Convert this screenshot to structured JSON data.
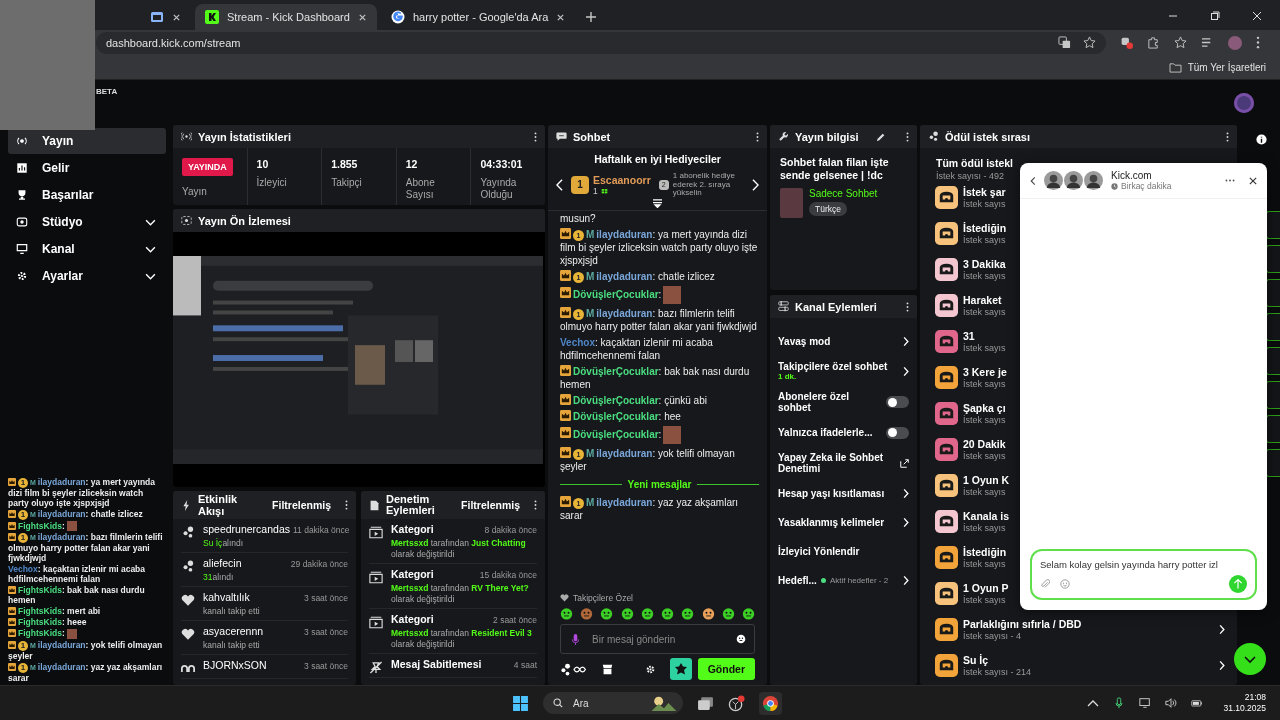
{
  "browser": {
    "tabs": [
      {
        "selected": false
      },
      {
        "title": "Stream - Kick Dashboard",
        "selected": true
      },
      {
        "title": "harry potter - Google'da Ara",
        "selected": false
      }
    ],
    "address": "dashboard.kick.com/stream",
    "bookmarks_folder": "Tüm Yer İşaretleri"
  },
  "header": {
    "badge": "BETA"
  },
  "sidebar": [
    {
      "label": "Yayın",
      "selected": true,
      "expandable": false
    },
    {
      "label": "Gelir",
      "selected": false,
      "expandable": false
    },
    {
      "label": "Başarılar",
      "selected": false,
      "expandable": false
    },
    {
      "label": "Stüdyo",
      "selected": false,
      "expandable": true
    },
    {
      "label": "Kanal",
      "selected": false,
      "expandable": true
    },
    {
      "label": "Ayarlar",
      "selected": false,
      "expandable": true
    }
  ],
  "stream_overlay": {
    "messages": [
      {
        "user": "ilaydaduran",
        "color": "#7aa7d9",
        "badges": [
          {
            "kind": "crown"
          },
          {
            "kind": "sub",
            "label": "1"
          },
          {
            "kind": "mod",
            "label": "M"
          }
        ],
        "kind": "text",
        "text": ": ya mert yayında dizi film bi şeyler izliceksin watch party oluyo işte xjspxjsjd"
      },
      {
        "user": "ilaydaduran",
        "color": "#7aa7d9",
        "badges": [
          {
            "kind": "crown"
          },
          {
            "kind": "sub",
            "label": "1"
          },
          {
            "kind": "mod",
            "label": "M"
          }
        ],
        "kind": "text",
        "text": ": chatle izlicez"
      },
      {
        "user": "FightsKids",
        "color": "#4ade80",
        "badges": [
          {
            "kind": "crown"
          }
        ],
        "kind": "emote",
        "text": ":"
      },
      {
        "user": "ilaydaduran",
        "color": "#7aa7d9",
        "badges": [
          {
            "kind": "crown"
          },
          {
            "kind": "sub",
            "label": "1"
          },
          {
            "kind": "mod",
            "label": "M"
          }
        ],
        "kind": "text",
        "text": ": bazı filmlerin telifi olmuyo harry potter falan akar yani fjwkdjwjd"
      },
      {
        "user": "Vechox",
        "color": "#4f86c6",
        "kind": "text",
        "text": ": kaçaktan izlenir mi acaba hdfilmcehennemi falan"
      },
      {
        "user": "FightsKids",
        "color": "#4ade80",
        "badges": [
          {
            "kind": "crown"
          }
        ],
        "kind": "text",
        "text": ": bak bak nası durdu hemen"
      },
      {
        "user": "FightsKids",
        "color": "#4ade80",
        "badges": [
          {
            "kind": "crown"
          }
        ],
        "kind": "text",
        "text": ": mert abi"
      },
      {
        "user": "FightsKids",
        "color": "#4ade80",
        "badges": [
          {
            "kind": "crown"
          }
        ],
        "kind": "text",
        "text": ": heee"
      },
      {
        "user": "FightsKids",
        "color": "#4ade80",
        "badges": [
          {
            "kind": "crown"
          }
        ],
        "kind": "emote",
        "text": ":"
      },
      {
        "user": "ilaydaduran",
        "color": "#7aa7d9",
        "badges": [
          {
            "kind": "crown"
          },
          {
            "kind": "sub",
            "label": "1"
          },
          {
            "kind": "mod",
            "label": "M"
          }
        ],
        "kind": "text",
        "text": ": yok telifi olmayan şeyler"
      },
      {
        "user": "ilaydaduran",
        "color": "#7aa7d9",
        "badges": [
          {
            "kind": "crown"
          },
          {
            "kind": "sub",
            "label": "1"
          },
          {
            "kind": "mod",
            "label": "M"
          }
        ],
        "kind": "text",
        "text": ": yaz yaz akşamları sarar"
      }
    ]
  },
  "stats": {
    "title": "Yayın İstatistikleri",
    "live_badge": "YAYINDA",
    "live_label": "Yayın",
    "items": [
      {
        "value": "10",
        "label": "İzleyici"
      },
      {
        "value": "1.855",
        "label": "Takipçi"
      },
      {
        "value": "12",
        "label": "Abone Sayısı"
      },
      {
        "value": "04:33:01",
        "label": "Yayında Olduğu"
      }
    ]
  },
  "preview": {
    "title": "Yayın Ön İzlemesi"
  },
  "activity": {
    "title": "Etkinlik Akışı",
    "filter": "Filtrelenmiş",
    "items": [
      {
        "kind": "reward",
        "user": "speedrunercandas",
        "time": "11 dakika önce",
        "highlight": "Su İç",
        "text": "alındı"
      },
      {
        "kind": "reward",
        "user": "aliefecin",
        "time": "29 dakika önce",
        "highlight": "31",
        "text": "alındı"
      },
      {
        "kind": "follow",
        "user": "kahvaltılık",
        "time": "3 saat önce",
        "text": "kanalı takip etti"
      },
      {
        "kind": "follow",
        "user": "asyacerennn",
        "time": "3 saat önce",
        "text": "kanalı takip etti"
      },
      {
        "kind": "other",
        "user": "BJORNxSON",
        "time": "3 saat önce"
      }
    ]
  },
  "moderation": {
    "title": "Denetim Eylemleri",
    "filter": "Filtrelenmiş",
    "items": [
      {
        "kind": "category",
        "title": "Kategori",
        "time": "8 dakika önce",
        "user": "Mertssxd",
        "by": "tarafından",
        "value": "Just Chatting",
        "suffix": "olarak değiştirildi"
      },
      {
        "kind": "category",
        "title": "Kategori",
        "time": "15 dakika önce",
        "user": "Mertssxd",
        "by": "tarafından",
        "value": "RV There Yet?",
        "suffix": "olarak değiştirildi"
      },
      {
        "kind": "category",
        "title": "Kategori",
        "time": "2 saat önce",
        "user": "Mertssxd",
        "by": "tarafından",
        "value": "Resident Evil 3",
        "suffix": "olarak değiştirildi"
      },
      {
        "kind": "pin",
        "title": "Mesaj Sabitlemesi",
        "time": "4 saat"
      }
    ]
  },
  "chat": {
    "title": "Sohbet",
    "gifters_title": "Haftalık en iyi Hediyeciler",
    "top_gifter": {
      "rank": "1",
      "name": "Escaanoorr",
      "count": "1"
    },
    "next_rank": "2",
    "next_hint": "1 abonelik hediye ederek 2. sıraya yükselin",
    "fragment": "musun?",
    "messages": [
      {
        "user": "ilaydaduran",
        "color": "#7aa7d9",
        "badges": [
          {
            "kind": "crown"
          },
          {
            "kind": "sub",
            "label": "1"
          },
          {
            "kind": "mod",
            "label": "M"
          }
        ],
        "kind": "text",
        "text": ": ya mert yayında dizi film bi şeyler izliceksin watch party oluyo işte xjspxjsjd"
      },
      {
        "user": "ilaydaduran",
        "color": "#7aa7d9",
        "badges": [
          {
            "kind": "crown"
          },
          {
            "kind": "sub",
            "label": "1"
          },
          {
            "kind": "mod",
            "label": "M"
          }
        ],
        "kind": "text",
        "text": ": chatle izlicez"
      },
      {
        "user": "DövüşlerÇocuklar",
        "color": "#4ade80",
        "badges": [
          {
            "kind": "crown"
          }
        ],
        "kind": "emote",
        "text": ":"
      },
      {
        "user": "ilaydaduran",
        "color": "#7aa7d9",
        "badges": [
          {
            "kind": "crown"
          },
          {
            "kind": "sub",
            "label": "1"
          },
          {
            "kind": "mod",
            "label": "M"
          }
        ],
        "kind": "text",
        "text": ": bazı filmlerin telifi olmuyo harry potter falan akar yani fjwkdjwjd"
      },
      {
        "user": "Vechox",
        "color": "#4f86c6",
        "kind": "text",
        "text": ": kaçaktan izlenir mi acaba hdfilmcehennemi falan"
      },
      {
        "user": "DövüşlerÇocuklar",
        "color": "#4ade80",
        "badges": [
          {
            "kind": "crown"
          }
        ],
        "kind": "text",
        "text": ": bak bak nası durdu hemen"
      },
      {
        "user": "DövüşlerÇocuklar",
        "color": "#4ade80",
        "badges": [
          {
            "kind": "crown"
          }
        ],
        "kind": "text",
        "text": ": çünkü abi"
      },
      {
        "user": "DövüşlerÇocuklar",
        "color": "#4ade80",
        "badges": [
          {
            "kind": "crown"
          }
        ],
        "kind": "text",
        "text": ": hee"
      },
      {
        "user": "DövüşlerÇocuklar",
        "color": "#4ade80",
        "badges": [
          {
            "kind": "crown"
          }
        ],
        "kind": "emote",
        "text": ":"
      },
      {
        "user": "ilaydaduran",
        "color": "#7aa7d9",
        "badges": [
          {
            "kind": "crown"
          },
          {
            "kind": "sub",
            "label": "1"
          },
          {
            "kind": "mod",
            "label": "M"
          }
        ],
        "kind": "text",
        "text": ": yok telifi olmayan şeyler"
      }
    ],
    "new_divider": "Yeni mesajlar",
    "new_messages": [
      {
        "user": "ilaydaduran",
        "color": "#7aa7d9",
        "badges": [
          {
            "kind": "crown"
          },
          {
            "kind": "sub",
            "label": "1"
          },
          {
            "kind": "mod",
            "label": "M"
          }
        ],
        "kind": "text",
        "text": ": yaz yaz akşamları sarar"
      }
    ],
    "emote_label": "Takipçilere Özel",
    "input_placeholder": "Bir mesaj gönderin",
    "send": "Gönder"
  },
  "stream_info": {
    "title": "Yayın bilgisi",
    "stream_title": "Sohbet falan filan işte sende gelsenee | !dc",
    "category": "Sadece Sohbet",
    "tag": "Türkçe"
  },
  "channel_actions": {
    "title": "Kanal Eylemleri",
    "items": [
      {
        "kind": "link",
        "label": "Yavaş mod"
      },
      {
        "kind": "link",
        "label": "Takipçilere özel sohbet",
        "note": "1 dk."
      },
      {
        "kind": "toggle",
        "label": "Abonelere özel sohbet",
        "on": false
      },
      {
        "kind": "toggle",
        "label": "Yalnızca ifadelerle...",
        "on": false
      },
      {
        "kind": "external",
        "label": "Yapay Zeka ile Sohbet Denetimi"
      },
      {
        "kind": "link",
        "label": "Hesap yaşı kısıtlaması"
      },
      {
        "kind": "link",
        "label": "Yasaklanmış kelimeler"
      },
      {
        "kind": "plain",
        "label": "İzleyici Yönlendir"
      },
      {
        "kind": "link",
        "label": "Hedefl...",
        "status": "Aktif hedefler - 2"
      }
    ]
  },
  "rewards": {
    "title": "Ödül istek sırası",
    "group_title": "Tüm ödül istekl",
    "group_count": "İstek sayısı - 492",
    "items": [
      {
        "title": "İstek şar",
        "count": "İstek sayıs",
        "color": "#f6c27c",
        "expandable": false
      },
      {
        "title": "İstediğin",
        "count": "İstek sayıs",
        "color": "#f6c27c",
        "expandable": false
      },
      {
        "title": "3 Dakika",
        "count": "İstek sayıs",
        "color": "#f3c6d0",
        "expandable": false
      },
      {
        "title": "Haraket",
        "count": "İstek sayıs",
        "color": "#f3c6d0",
        "expandable": false
      },
      {
        "title": "31",
        "count": "İstek sayıs",
        "color": "#e0678b",
        "expandable": false
      },
      {
        "title": "3 Kere je",
        "count": "İstek sayıs",
        "color": "#f2a33a",
        "expandable": false
      },
      {
        "title": "Şapka çı",
        "count": "İstek sayıs",
        "color": "#e0678b",
        "expandable": false
      },
      {
        "title": "20 Dakik",
        "count": "İstek sayıs",
        "color": "#e0678b",
        "expandable": false
      },
      {
        "title": "1 Oyun K",
        "count": "İstek sayıs",
        "color": "#f6c27c",
        "expandable": false
      },
      {
        "title": "Kanala is",
        "count": "İstek sayıs",
        "color": "#f3c6d0",
        "expandable": false
      },
      {
        "title": "İstediğin",
        "count": "İstek sayıs",
        "color": "#f2a33a",
        "expandable": false
      },
      {
        "title": "1 Oyun P",
        "count": "İstek sayıs",
        "color": "#f6c27c",
        "expandable": false
      },
      {
        "title": "Parlaklığını sıfırla / DBD",
        "count": "İstek sayısı - 4",
        "color": "#f2a33a",
        "expandable": true
      },
      {
        "title": "Su İç",
        "count": "İstek sayısı - 214",
        "color": "#f2a33a",
        "expandable": true
      }
    ]
  },
  "popup": {
    "title": "Kick.com",
    "status": "Birkaç dakika",
    "message_value": "Selam kolay gelsin yayında harry potter izl"
  },
  "taskbar": {
    "search_placeholder": "Ara",
    "time": "21:08",
    "date": "31.10.2025"
  }
}
